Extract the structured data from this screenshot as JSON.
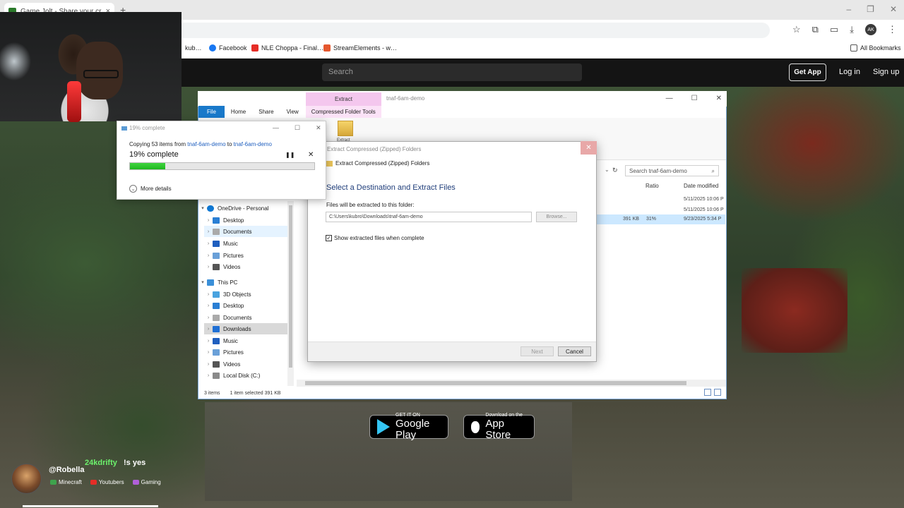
{
  "browser": {
    "tab_title": "Game Jolt - Share your creatio",
    "new_tab": "+",
    "tab_close": "×",
    "bookmarks": [
      {
        "label": "kub…",
        "color": "#888888"
      },
      {
        "label": "Facebook",
        "color": "#1877f2"
      },
      {
        "label": "NLE Choppa - Final…",
        "color": "#e52d27"
      },
      {
        "label": "StreamElements - w…",
        "color": "#e4572e"
      }
    ],
    "all_bookmarks": "All Bookmarks",
    "profile_initials": "AK"
  },
  "site": {
    "search_placeholder": "Search",
    "get_app": "Get App",
    "login": "Log in",
    "signup": "Sign up"
  },
  "explorer": {
    "title": "tnaf-6am-demo",
    "context_tab": "Extract",
    "ribbon_tabs": [
      "File",
      "Home",
      "Share",
      "View",
      "Compressed Folder Tools"
    ],
    "extract_label": "Extract",
    "search_placeholder": "Search tnaf-6am-demo",
    "columns": {
      "ratio": "Ratio",
      "date": "Date modified"
    },
    "rows": [
      {
        "date": "5/11/2025 10:06 P"
      },
      {
        "date": "5/11/2025 10:06 P"
      },
      {
        "size": "391 KB",
        "ratio": "31%",
        "date": "9/23/2025 5:34 P"
      }
    ],
    "nav": [
      {
        "label": "OneDrive - Personal",
        "color": "#0f78d4",
        "expanded": true
      },
      {
        "label": "Desktop",
        "color": "#2a7fd4"
      },
      {
        "label": "Documents",
        "color": "#aaaaaa"
      },
      {
        "label": "Music",
        "color": "#1f5fbf"
      },
      {
        "label": "Pictures",
        "color": "#6aa0d8"
      },
      {
        "label": "Videos",
        "color": "#555555"
      },
      {
        "label": "This PC",
        "color": "#3a8fd8",
        "expanded": true
      },
      {
        "label": "3D Objects",
        "color": "#4aa3df"
      },
      {
        "label": "Desktop",
        "color": "#2a7fd4"
      },
      {
        "label": "Documents",
        "color": "#aaaaaa"
      },
      {
        "label": "Downloads",
        "color": "#1f6fd4"
      },
      {
        "label": "Music",
        "color": "#1f5fbf"
      },
      {
        "label": "Pictures",
        "color": "#6aa0d8"
      },
      {
        "label": "Videos",
        "color": "#555555"
      },
      {
        "label": "Local Disk (C:)",
        "color": "#8a8a8a"
      }
    ],
    "status": {
      "items": "3 items",
      "selected": "1 item selected  391 KB"
    }
  },
  "extract_dialog": {
    "title": "Extract Compressed (Zipped) Folders",
    "subtitle": "Extract Compressed (Zipped) Folders",
    "heading": "Select a Destination and Extract Files",
    "path_label": "Files will be extracted to this folder:",
    "path_value": "C:\\Users\\kubro\\Downloads\\tnaf-6am-demo",
    "browse": "Browse...",
    "checkbox_label": "Show extracted files when complete",
    "checked": true,
    "next": "Next",
    "cancel": "Cancel"
  },
  "copy_dialog": {
    "title": "19% complete",
    "copying_prefix": "Copying 53 items from",
    "source": "tnaf-6am-demo",
    "to_word": "to",
    "destination": "tnaf-6am-demo",
    "percent_text": "19% complete",
    "progress_fraction": 0.19,
    "more_details": "More details"
  },
  "badges": {
    "gplay_small": "GET IT ON",
    "gplay_big": "Google Play",
    "astore_small": "Download on the",
    "astore_big": "App Store"
  },
  "chat": {
    "user": "@Robella",
    "sender": "24kdrifty",
    "message": "!s yes",
    "tags": [
      {
        "label": "Minecraft",
        "color": "#3fa34d"
      },
      {
        "label": "Youtubers",
        "color": "#e52d27"
      },
      {
        "label": "Gaming",
        "color": "#b05fd8"
      }
    ]
  }
}
